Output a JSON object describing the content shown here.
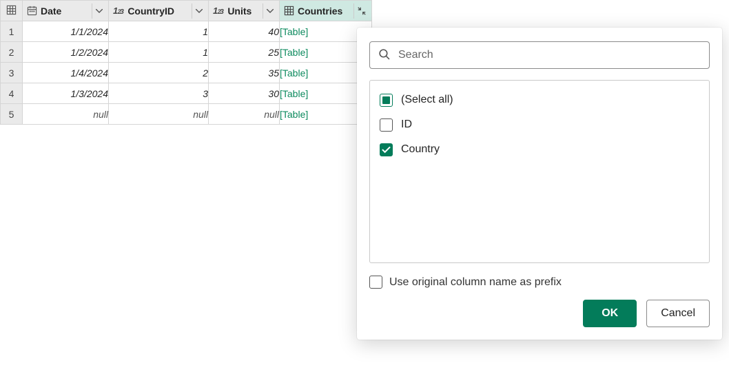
{
  "columns": [
    {
      "name": "Date",
      "type": "date"
    },
    {
      "name": "CountryID",
      "type": "int"
    },
    {
      "name": "Units",
      "type": "int"
    },
    {
      "name": "Countries",
      "type": "table"
    }
  ],
  "rows": [
    {
      "n": "1",
      "date": "1/1/2024",
      "countryId": "1",
      "units": "40",
      "countries": "[Table]"
    },
    {
      "n": "2",
      "date": "1/2/2024",
      "countryId": "1",
      "units": "25",
      "countries": "[Table]"
    },
    {
      "n": "3",
      "date": "1/4/2024",
      "countryId": "2",
      "units": "35",
      "countries": "[Table]"
    },
    {
      "n": "4",
      "date": "1/3/2024",
      "countryId": "3",
      "units": "30",
      "countries": "[Table]"
    },
    {
      "n": "5",
      "date": "null",
      "countryId": "null",
      "units": "null",
      "countries": "[Table]"
    }
  ],
  "popup": {
    "search_placeholder": "Search",
    "select_all_label": "(Select all)",
    "options": [
      {
        "label": "ID",
        "checked": false
      },
      {
        "label": "Country",
        "checked": true
      }
    ],
    "prefix_label": "Use original column name as prefix",
    "prefix_checked": false,
    "ok_label": "OK",
    "cancel_label": "Cancel"
  }
}
